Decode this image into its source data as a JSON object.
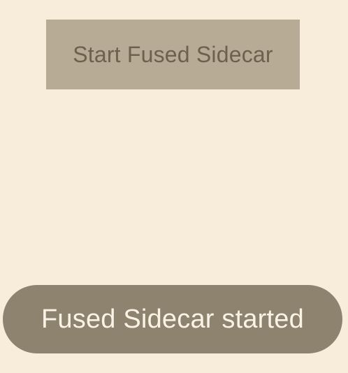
{
  "screen": {
    "background_color": "#f8eddb"
  },
  "buttons": {
    "start_label": "Start Fused Sidecar",
    "start_bg_color": "#b8ab95",
    "start_text_color": "#6b614f"
  },
  "toast": {
    "message": "Fused Sidecar started",
    "bg_color": "#8e836f",
    "text_color": "#fbf3e6"
  }
}
